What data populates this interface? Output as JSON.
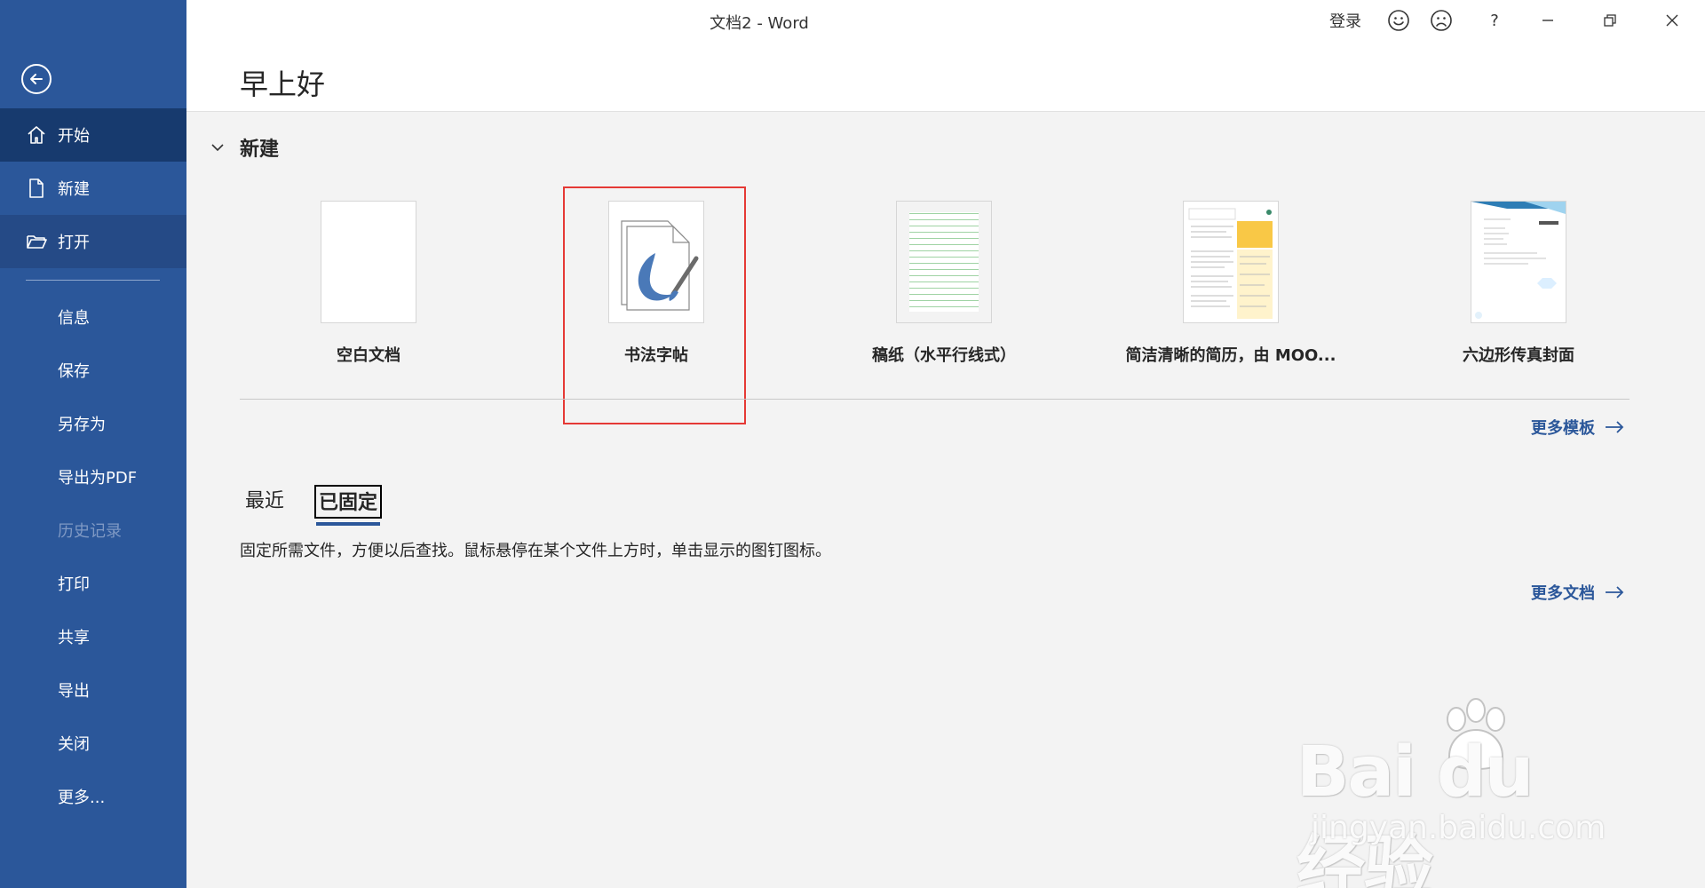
{
  "window": {
    "title": "文档2  -  Word",
    "signin_label": "登录",
    "help_label": "?",
    "icons": [
      "smile-icon",
      "frown-icon",
      "minimize-icon",
      "restore-icon",
      "close-icon"
    ]
  },
  "header": {
    "greeting": "早上好"
  },
  "sidebar": {
    "back_icon": "back-arrow-icon",
    "items": [
      {
        "label": "开始",
        "icon": "home-icon",
        "state": "active"
      },
      {
        "label": "新建",
        "icon": "new-document-icon",
        "state": "normal"
      },
      {
        "label": "打开",
        "icon": "open-folder-icon",
        "state": "hover"
      },
      {
        "label": "信息",
        "state": "normal"
      },
      {
        "label": "保存",
        "state": "normal"
      },
      {
        "label": "另存为",
        "state": "normal"
      },
      {
        "label": "导出为PDF",
        "state": "normal"
      },
      {
        "label": "历史记录",
        "state": "disabled"
      },
      {
        "label": "打印",
        "state": "normal"
      },
      {
        "label": "共享",
        "state": "normal"
      },
      {
        "label": "导出",
        "state": "normal"
      },
      {
        "label": "关闭",
        "state": "normal"
      },
      {
        "label": "更多...",
        "state": "normal"
      }
    ]
  },
  "new_section": {
    "title": "新建",
    "templates": [
      {
        "label": "空白文档",
        "thumb": "blank"
      },
      {
        "label": "书法字帖",
        "thumb": "calligraphy",
        "highlighted": true
      },
      {
        "label": "稿纸（水平行线式）",
        "thumb": "lined-paper"
      },
      {
        "label": "简洁清晰的简历，由 MOO...",
        "thumb": "resume"
      },
      {
        "label": "六边形传真封面",
        "thumb": "hexagon-fax"
      }
    ],
    "more_templates_label": "更多模板"
  },
  "recent": {
    "tabs": [
      {
        "label": "最近",
        "selected": false
      },
      {
        "label": "已固定",
        "selected": true
      }
    ],
    "pinned_hint": "固定所需文件，方便以后查找。鼠标悬停在某个文件上方时，单击显示的图钉图标。",
    "more_documents_label": "更多文档"
  },
  "watermark": {
    "main": "Bai du 经验",
    "sub": "jingyan.baidu.com"
  },
  "colors": {
    "sidebar": "#2b579a",
    "sidebar_active": "#173a6e",
    "accent": "#2b579a",
    "highlight": "#e53935"
  }
}
